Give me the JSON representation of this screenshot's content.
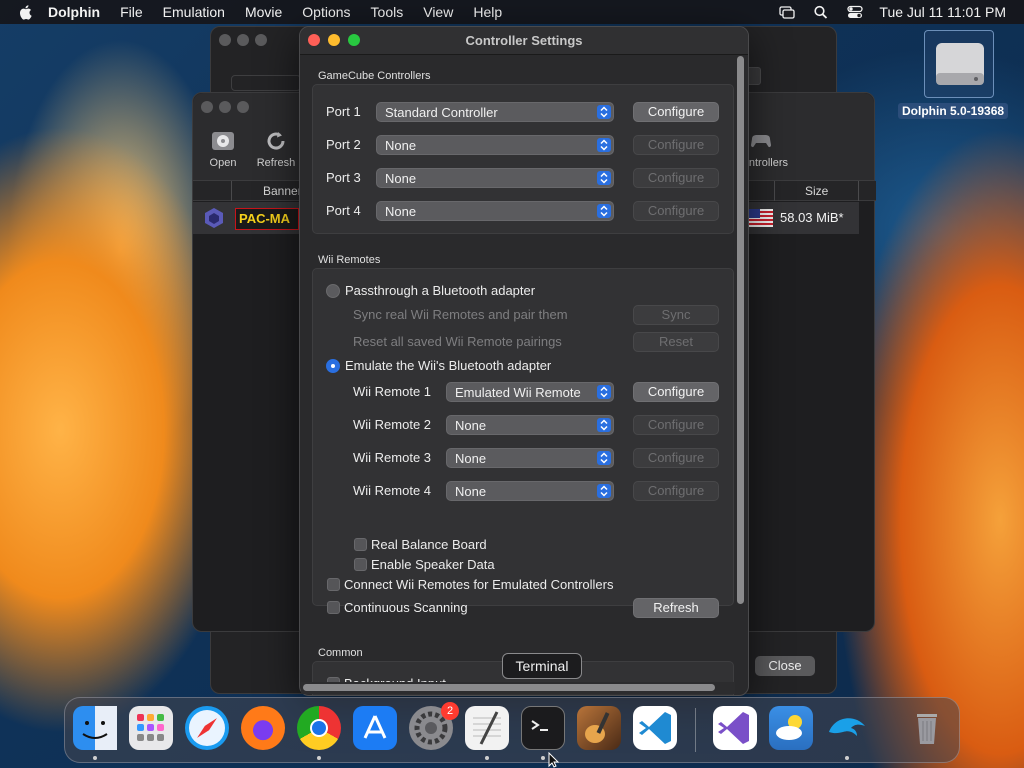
{
  "menubar": {
    "app_name": "Dolphin",
    "items": [
      "File",
      "Emulation",
      "Movie",
      "Options",
      "Tools",
      "View",
      "Help"
    ],
    "clock": "Tue Jul 11  11:01 PM"
  },
  "desktop": {
    "disk_label": "Dolphin 5.0-19368"
  },
  "main_window": {
    "tools": [
      "Open",
      "Refresh",
      "Controllers"
    ],
    "columns": [
      "Banner",
      "Size"
    ],
    "game_row": {
      "banner_text": "PAC-MA",
      "size": "58.03 MiB*"
    }
  },
  "back_window": {
    "close_label": "Close"
  },
  "dialog": {
    "title": "Controller Settings",
    "gamecube": {
      "title": "GameCube Controllers",
      "ports": [
        {
          "label": "Port 1",
          "value": "Standard Controller",
          "button": "Configure",
          "enabled": true
        },
        {
          "label": "Port 2",
          "value": "None",
          "button": "Configure",
          "enabled": false
        },
        {
          "label": "Port 3",
          "value": "None",
          "button": "Configure",
          "enabled": false
        },
        {
          "label": "Port 4",
          "value": "None",
          "button": "Configure",
          "enabled": false
        }
      ]
    },
    "wii": {
      "title": "Wii Remotes",
      "passthrough_label": "Passthrough a Bluetooth adapter",
      "sync_text": "Sync real Wii Remotes and pair them",
      "sync_button": "Sync",
      "reset_text": "Reset all saved Wii Remote pairings",
      "reset_button": "Reset",
      "emulate_label": "Emulate the Wii's Bluetooth adapter",
      "remotes": [
        {
          "label": "Wii Remote 1",
          "value": "Emulated Wii Remote",
          "button": "Configure",
          "enabled": true
        },
        {
          "label": "Wii Remote 2",
          "value": "None",
          "button": "Configure",
          "enabled": false
        },
        {
          "label": "Wii Remote 3",
          "value": "None",
          "button": "Configure",
          "enabled": false
        },
        {
          "label": "Wii Remote 4",
          "value": "None",
          "button": "Configure",
          "enabled": false
        }
      ],
      "balance_board": "Real Balance Board",
      "speaker_data": "Enable Speaker Data",
      "connect_emulated": "Connect Wii Remotes for Emulated Controllers",
      "continuous_scanning": "Continuous Scanning",
      "refresh_button": "Refresh"
    },
    "common": {
      "title": "Common",
      "background_input": "Background Input"
    }
  },
  "tooltip": "Terminal",
  "dock": {
    "apps": [
      {
        "name": "Finder",
        "color": "#2d8ef0"
      },
      {
        "name": "Launchpad",
        "color": "#e8e8ea"
      },
      {
        "name": "Safari",
        "color": "#1a9bf0"
      },
      {
        "name": "Firefox",
        "color": "#ff7a18"
      },
      {
        "name": "Chrome",
        "color": "#e8e8ea"
      },
      {
        "name": "App Store",
        "color": "#1c7cf4"
      },
      {
        "name": "System Settings",
        "color": "#8a8a8e",
        "badge": "2"
      },
      {
        "name": "TextEdit",
        "color": "#f2f2f2"
      },
      {
        "name": "Terminal",
        "color": "#1b1b1d"
      },
      {
        "name": "Instruments",
        "color": "#6b4a2f"
      },
      {
        "name": "Visual Studio Code",
        "color": "#ffffff"
      },
      {
        "name": "Visual Studio",
        "color": "#ffffff"
      },
      {
        "name": "Weather",
        "color": "#2e8fe6"
      },
      {
        "name": "Dolphin",
        "color": "#1aa0e8"
      },
      {
        "name": "Trash",
        "color": "#9a9aa0"
      }
    ]
  }
}
